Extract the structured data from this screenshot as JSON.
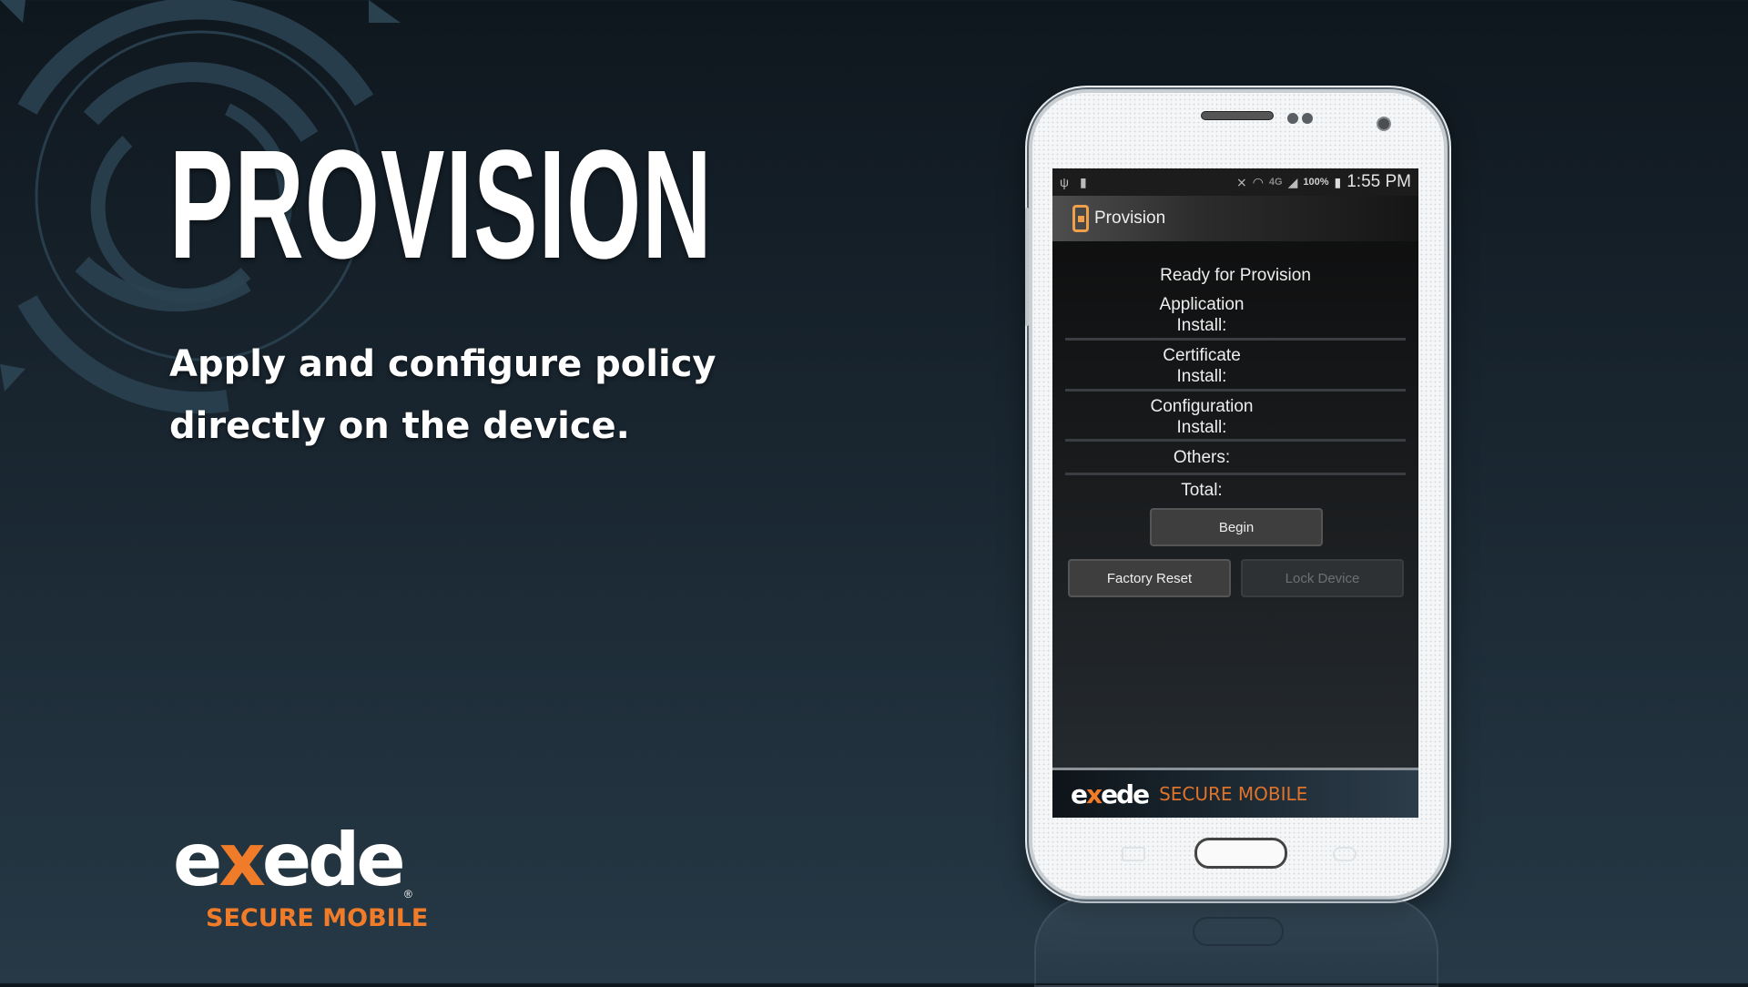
{
  "hero": {
    "title": "PROVISION",
    "tagline_line1": "Apply and configure policy",
    "tagline_line2": "directly on the device."
  },
  "brand": {
    "word_pre": "e",
    "word_x": "x",
    "word_post": "ede",
    "registered": "®",
    "subtitle": "SECURE MOBILE",
    "accent_color": "#f07c2a"
  },
  "phone": {
    "status_bar": {
      "left_icons": [
        "usb-icon",
        "battery-saver-icon"
      ],
      "right_icons": [
        "vibrate-mute-icon",
        "wifi-icon",
        "4g-icon",
        "signal-icon"
      ],
      "network": "4G",
      "battery": "100%",
      "time": "1:55 PM"
    },
    "app_bar": {
      "icon": "phone-lock-icon",
      "title": "Provision"
    },
    "screen": {
      "status_heading": "Ready for Provision",
      "rows": [
        {
          "label_line1": "Application",
          "label_line2": "Install:"
        },
        {
          "label_line1": "Certificate",
          "label_line2": "Install:"
        },
        {
          "label_line1": "Configuration",
          "label_line2": "Install:"
        },
        {
          "label_line1": "Others:",
          "label_line2": ""
        },
        {
          "label_line1": "Total:",
          "label_line2": ""
        }
      ],
      "buttons": {
        "begin": "Begin",
        "factory_reset": "Factory Reset",
        "lock_device": "Lock Device"
      }
    },
    "banner": {
      "word_pre": "e",
      "word_x": "x",
      "word_post": "ede",
      "subtitle": "SECURE MOBILE"
    }
  }
}
